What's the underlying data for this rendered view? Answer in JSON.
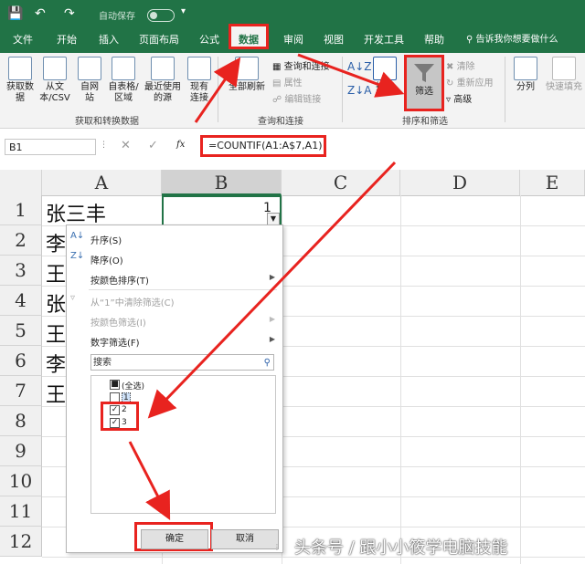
{
  "titlebar": {
    "autosave_label": "自动保存",
    "icons": [
      "save-icon",
      "undo-icon",
      "redo-icon",
      "customize-icon"
    ]
  },
  "tabs": [
    "文件",
    "开始",
    "插入",
    "页面布局",
    "公式",
    "数据",
    "审阅",
    "视图",
    "开发工具",
    "帮助"
  ],
  "active_tab": "数据",
  "tell_me": "告诉我你想要做什么",
  "ribbon": {
    "get_data": "获取数据",
    "from_text_csv": "从文本/CSV",
    "from_web": "自网站",
    "from_table": "自表格/区域",
    "recent_sources": "最近使用的源",
    "existing_connections": "现有连接",
    "group_get_transform": "获取和转换数据",
    "refresh_all": "全部刷新",
    "queries_connections": "查询和连接",
    "properties": "属性",
    "edit_links": "编辑链接",
    "group_queries": "查询和连接",
    "sort": "排序",
    "filter": "筛选",
    "clear": "清除",
    "reapply": "重新应用",
    "advanced": "高级",
    "group_sort_filter": "排序和筛选",
    "text_to_columns": "分列",
    "flash_fill": "快速填充"
  },
  "formula_bar": {
    "name_box": "B1",
    "fx": "fx",
    "formula": "=COUNTIF(A1:A$7,A1)"
  },
  "columns": [
    "A",
    "B",
    "C",
    "D",
    "E"
  ],
  "rows": [
    "1",
    "2",
    "3",
    "4",
    "5",
    "6",
    "7",
    "8",
    "9",
    "10",
    "11",
    "12"
  ],
  "cells_a": [
    "张三丰",
    "李",
    "王",
    "张",
    "王",
    "李",
    "王"
  ],
  "cell_b1": "1",
  "dropdown": {
    "sort_asc": "升序(S)",
    "sort_desc": "降序(O)",
    "sort_by_color": "按颜色排序(T)",
    "clear_filter": "从“1”中清除筛选(C)",
    "filter_by_color": "按颜色筛选(I)",
    "number_filters": "数字筛选(F)",
    "search_placeholder": "搜索",
    "items": [
      {
        "label": "(全选)",
        "state": "partial"
      },
      {
        "label": "1",
        "state": "unchecked"
      },
      {
        "label": "2",
        "state": "checked"
      },
      {
        "label": "3",
        "state": "checked"
      }
    ],
    "ok": "确定",
    "cancel": "取消"
  },
  "watermark": "头条号 / 跟小小筱学电脑技能",
  "colors": {
    "excel_green": "#217346",
    "highlight_red": "#e8231f"
  }
}
